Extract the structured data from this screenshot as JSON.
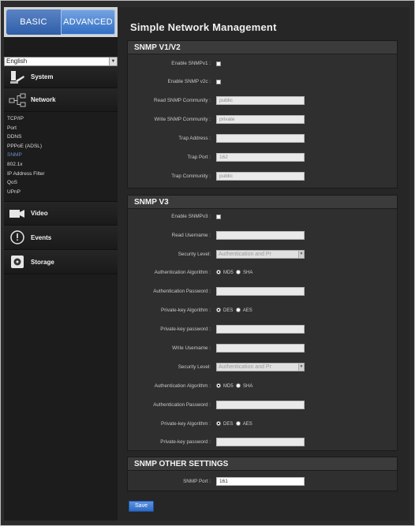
{
  "nav": {
    "basic": "BASIC",
    "advanced": "ADVANCED"
  },
  "language": "English",
  "sidebar": {
    "system": "System",
    "network": "Network",
    "network_items": [
      "TCP/IP",
      "Port",
      "DDNS",
      "PPPoE (ADSL)",
      "SNMP",
      "802.1x",
      "IP Address Filter",
      "QoS",
      "UPnP"
    ],
    "active_item": "SNMP",
    "video": "Video",
    "events": "Events",
    "storage": "Storage"
  },
  "page": {
    "title": "Simple Network Management"
  },
  "v1v2": {
    "title": "SNMP V1/V2",
    "enable_v1": "Enable SNMPv1 :",
    "enable_v2c": "Enable SNMP v2c :",
    "read_community": "Read SNMP Community :",
    "read_community_value": "public",
    "write_community": "Write SNMP Community :",
    "write_community_value": "private",
    "trap_address": "Trap Address :",
    "trap_address_value": "",
    "trap_port": "Trap Port :",
    "trap_port_value": "162",
    "trap_community": "Trap Community :",
    "trap_community_value": "public"
  },
  "v3": {
    "title": "SNMP V3",
    "enable_v3": "Enable SNMPv3 :",
    "read_username": "Read Username :",
    "security_level": "Security Level:",
    "security_level_value": "Authentication and Pr",
    "auth_algorithm": "Authentication Algorithm :",
    "md5": "MD5",
    "sha": "SHA",
    "auth_password": "Authentication Password :",
    "privkey_algorithm": "Private-key Algorithm :",
    "des": "DES",
    "aes": "AES",
    "privkey_password": "Private-key password :",
    "write_username": "Write Username :"
  },
  "other": {
    "title": "SNMP OTHER SETTINGS",
    "snmp_port": "SNMP Port :",
    "snmp_port_value": "161"
  },
  "save": "Save"
}
